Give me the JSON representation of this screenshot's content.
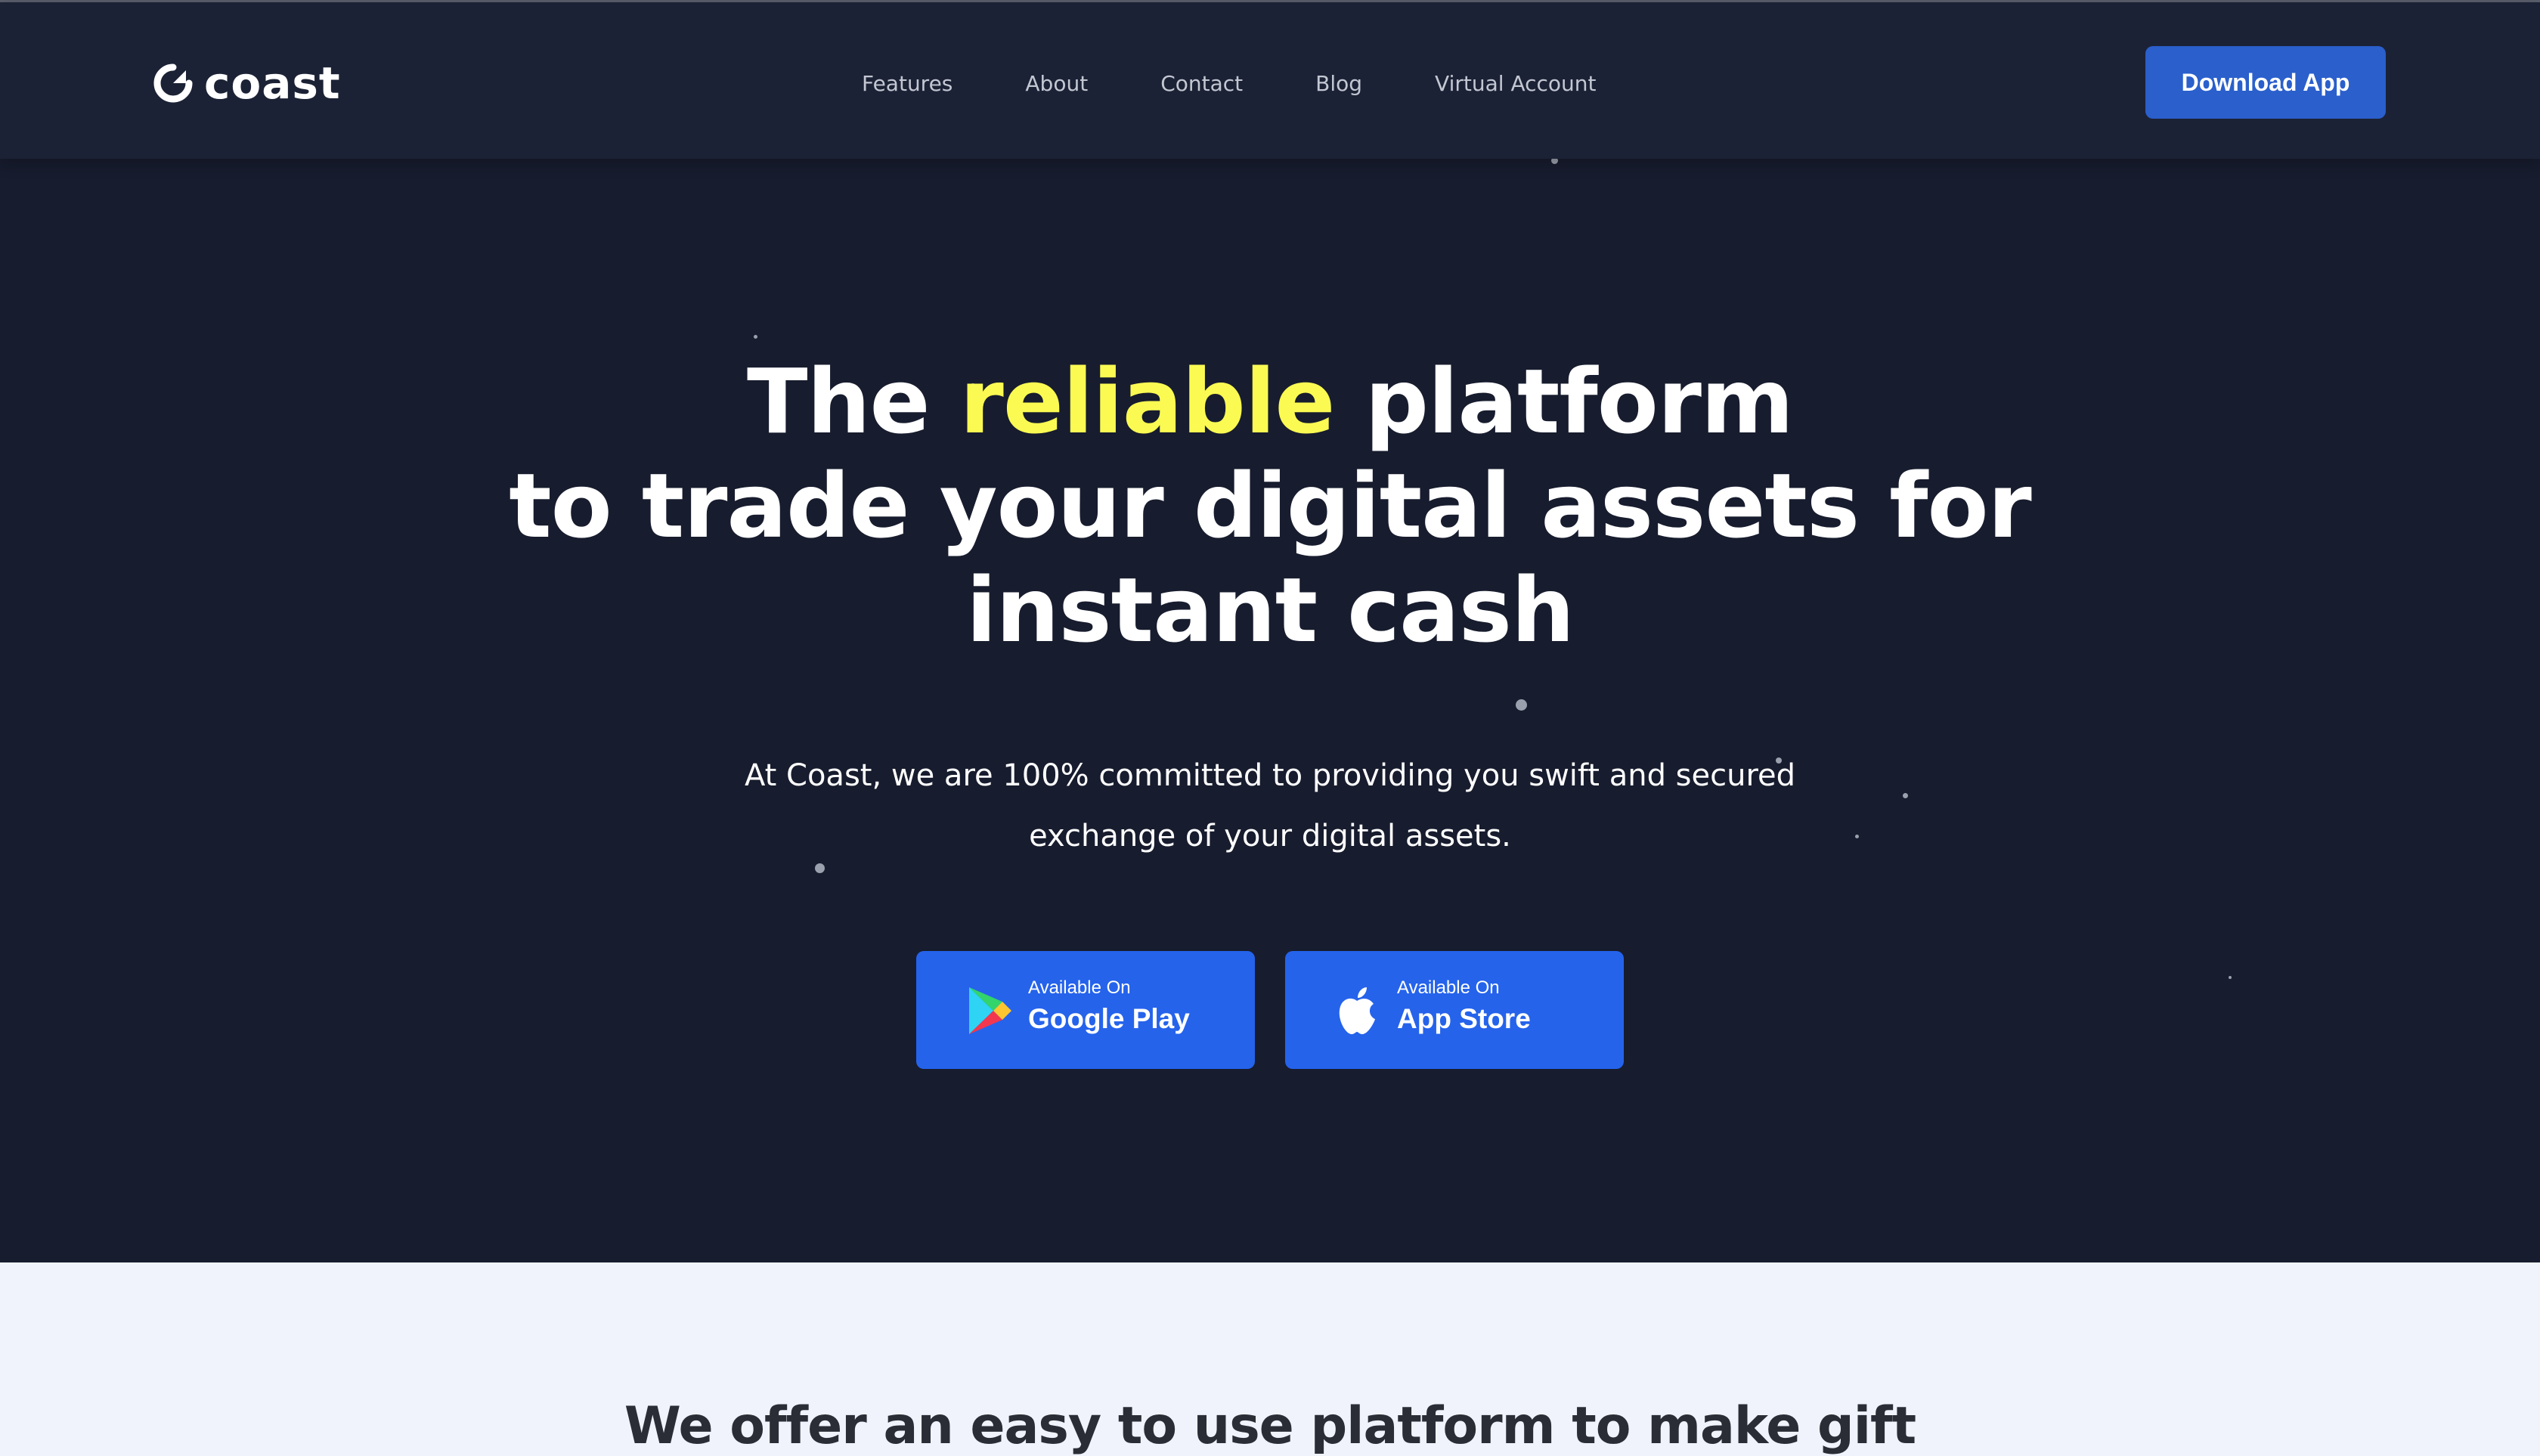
{
  "brand": {
    "name": "coast"
  },
  "nav": {
    "items": [
      {
        "label": "Features"
      },
      {
        "label": "About"
      },
      {
        "label": "Contact"
      },
      {
        "label": "Blog"
      },
      {
        "label": "Virtual Account"
      }
    ],
    "download_label": "Download App"
  },
  "hero": {
    "headline_line1_before": "The ",
    "headline_line1_accent": "reliable",
    "headline_line1_after": " platform",
    "headline_line2": "to trade your digital assets for",
    "headline_line3": "instant cash",
    "subtext_line1": "At Coast, we are 100% committed to providing you swift and secured",
    "subtext_line2": "exchange of your digital assets.",
    "stores": {
      "google": {
        "small": "Available On",
        "big": "Google Play",
        "icon": "google-play-icon"
      },
      "apple": {
        "small": "Available On",
        "big": "App Store",
        "icon": "apple-icon"
      }
    }
  },
  "features": {
    "title": "We offer an easy to use platform to make gift"
  },
  "colors": {
    "hero_bg": "#171c2e",
    "nav_bg": "#1c2235",
    "accent_yellow": "#fafa52",
    "button_blue": "#2563eb",
    "download_blue": "#2a5fcc",
    "section_bg": "#f0f3fb"
  }
}
